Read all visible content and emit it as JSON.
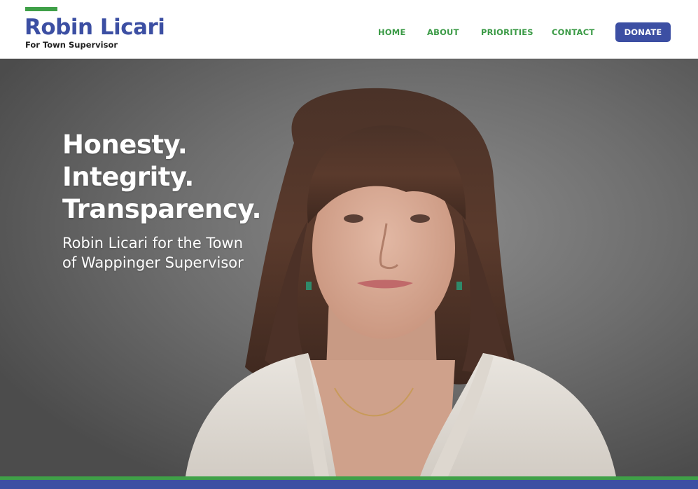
{
  "header": {
    "logo_name": "Robin Licari",
    "logo_subtitle": "For Town Supervisor",
    "nav": [
      {
        "label": "HOME"
      },
      {
        "label": "ABOUT"
      },
      {
        "label": "PRIORITIES"
      },
      {
        "label": "CONTACT"
      }
    ],
    "donate_label": "DONATE"
  },
  "hero": {
    "headline": [
      "Honesty.",
      "Integrity.",
      "Transparency."
    ],
    "tagline": [
      "Robin Licari for the Town",
      "of Wappinger Supervisor"
    ],
    "image_icon": "candidate-portrait"
  },
  "colors": {
    "brand_blue": "#3c4fa3",
    "brand_green": "#3fa048",
    "nav_green": "#3a9a45",
    "hero_bg": "#6f6f6f"
  }
}
